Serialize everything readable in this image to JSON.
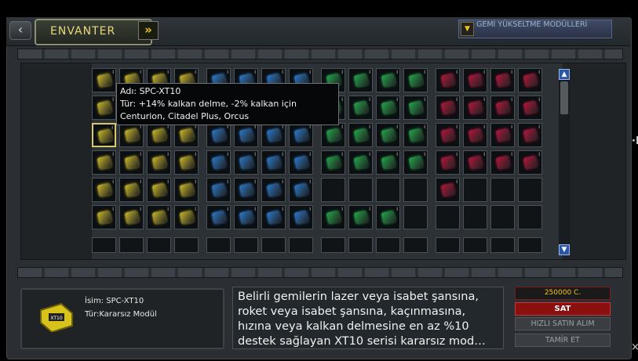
{
  "header": {
    "back_label": "‹",
    "tab_label": "ENVANTER",
    "forward_label": "»",
    "module_select": "GEMİ YÜKSELTME MODÜLLERİ",
    "module_select_arrow": "▼"
  },
  "tooltip": {
    "name_line": "Adı: SPC-XT10",
    "type_line": "Tür: +14% kalkan delme, -2% kalkan için Centurion, Citadel Plus, Orcus"
  },
  "grid": {
    "groups": [
      {
        "color": "#c9b72a",
        "rows": [
          [
            "I",
            "I",
            "I",
            "I"
          ],
          [
            "I",
            "I",
            "I",
            "I"
          ],
          [
            "I",
            "I",
            "I",
            "I"
          ],
          [
            "I",
            "I",
            "I",
            "I"
          ],
          [
            "I",
            "I",
            "I",
            "I"
          ],
          [
            "I",
            "I",
            "I",
            "I"
          ]
        ]
      },
      {
        "color": "#2a78c9",
        "rows": [
          [
            "I",
            "I",
            "I",
            "I"
          ],
          [
            "I",
            "I",
            "I",
            "I"
          ],
          [
            "I",
            "I",
            "I",
            "I"
          ],
          [
            "I",
            "I",
            "I",
            "I"
          ],
          [
            "I",
            "I",
            "I",
            "I"
          ],
          [
            "I",
            "I",
            "I",
            "I"
          ]
        ]
      },
      {
        "color": "#22a64a",
        "rows": [
          [
            "I",
            "I",
            "I",
            "I"
          ],
          [
            "I",
            "I",
            "I",
            "I"
          ],
          [
            "I",
            "I",
            "I",
            "I"
          ],
          [
            "I",
            "I",
            "I",
            "I"
          ],
          [
            "",
            "",
            "",
            ""
          ],
          [
            "I",
            "I",
            "I",
            ""
          ]
        ]
      },
      {
        "color": "#b0163b",
        "rows": [
          [
            "I",
            "I",
            "I",
            "I"
          ],
          [
            "I",
            "I",
            "I",
            "I"
          ],
          [
            "I",
            "I",
            "I",
            "I"
          ],
          [
            "I",
            "I",
            "I",
            "I"
          ],
          [
            "I",
            "",
            "",
            ""
          ],
          [
            "",
            "",
            "",
            ""
          ]
        ]
      }
    ],
    "selected": "SPC-XT10"
  },
  "detail": {
    "name": "İsim: SPC-XT10",
    "type": "Tür:Kararsız Modül"
  },
  "description": "Belirli gemilerin lazer veya isabet şansına, roket veya isabet şansına, kaçınmasına, hızına veya kalkan delmesine en az %10 destek sağlayan XT10 serisi kararsız mod…",
  "actions": {
    "price": "250000 C.",
    "sell": "SAT",
    "quick_buy": "HIZLI SATIN ALIM",
    "repair": "TAMİR ET"
  },
  "scrollbar": {
    "up": "▲",
    "down": "▼"
  },
  "colors": {
    "accent": "#f2c518",
    "sell": "#8a1010"
  }
}
